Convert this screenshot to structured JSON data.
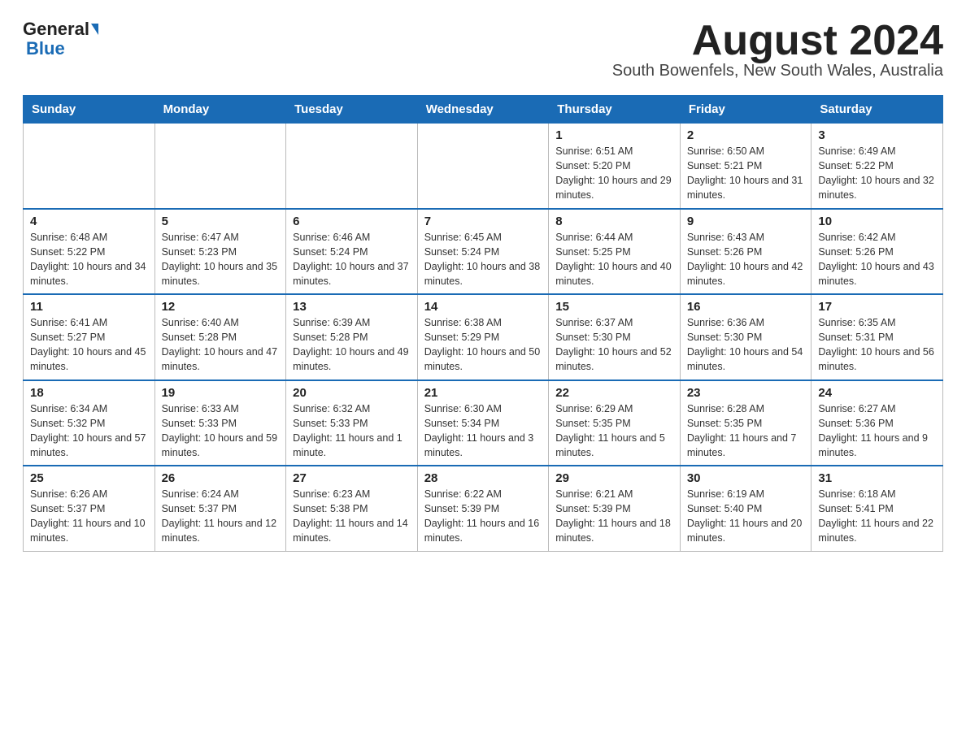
{
  "header": {
    "logo_general": "General",
    "logo_blue": "Blue",
    "month_title": "August 2024",
    "subtitle": "South Bowenfels, New South Wales, Australia"
  },
  "weekdays": [
    "Sunday",
    "Monday",
    "Tuesday",
    "Wednesday",
    "Thursday",
    "Friday",
    "Saturday"
  ],
  "weeks": [
    [
      {
        "day": "",
        "info": ""
      },
      {
        "day": "",
        "info": ""
      },
      {
        "day": "",
        "info": ""
      },
      {
        "day": "",
        "info": ""
      },
      {
        "day": "1",
        "info": "Sunrise: 6:51 AM\nSunset: 5:20 PM\nDaylight: 10 hours and 29 minutes."
      },
      {
        "day": "2",
        "info": "Sunrise: 6:50 AM\nSunset: 5:21 PM\nDaylight: 10 hours and 31 minutes."
      },
      {
        "day": "3",
        "info": "Sunrise: 6:49 AM\nSunset: 5:22 PM\nDaylight: 10 hours and 32 minutes."
      }
    ],
    [
      {
        "day": "4",
        "info": "Sunrise: 6:48 AM\nSunset: 5:22 PM\nDaylight: 10 hours and 34 minutes."
      },
      {
        "day": "5",
        "info": "Sunrise: 6:47 AM\nSunset: 5:23 PM\nDaylight: 10 hours and 35 minutes."
      },
      {
        "day": "6",
        "info": "Sunrise: 6:46 AM\nSunset: 5:24 PM\nDaylight: 10 hours and 37 minutes."
      },
      {
        "day": "7",
        "info": "Sunrise: 6:45 AM\nSunset: 5:24 PM\nDaylight: 10 hours and 38 minutes."
      },
      {
        "day": "8",
        "info": "Sunrise: 6:44 AM\nSunset: 5:25 PM\nDaylight: 10 hours and 40 minutes."
      },
      {
        "day": "9",
        "info": "Sunrise: 6:43 AM\nSunset: 5:26 PM\nDaylight: 10 hours and 42 minutes."
      },
      {
        "day": "10",
        "info": "Sunrise: 6:42 AM\nSunset: 5:26 PM\nDaylight: 10 hours and 43 minutes."
      }
    ],
    [
      {
        "day": "11",
        "info": "Sunrise: 6:41 AM\nSunset: 5:27 PM\nDaylight: 10 hours and 45 minutes."
      },
      {
        "day": "12",
        "info": "Sunrise: 6:40 AM\nSunset: 5:28 PM\nDaylight: 10 hours and 47 minutes."
      },
      {
        "day": "13",
        "info": "Sunrise: 6:39 AM\nSunset: 5:28 PM\nDaylight: 10 hours and 49 minutes."
      },
      {
        "day": "14",
        "info": "Sunrise: 6:38 AM\nSunset: 5:29 PM\nDaylight: 10 hours and 50 minutes."
      },
      {
        "day": "15",
        "info": "Sunrise: 6:37 AM\nSunset: 5:30 PM\nDaylight: 10 hours and 52 minutes."
      },
      {
        "day": "16",
        "info": "Sunrise: 6:36 AM\nSunset: 5:30 PM\nDaylight: 10 hours and 54 minutes."
      },
      {
        "day": "17",
        "info": "Sunrise: 6:35 AM\nSunset: 5:31 PM\nDaylight: 10 hours and 56 minutes."
      }
    ],
    [
      {
        "day": "18",
        "info": "Sunrise: 6:34 AM\nSunset: 5:32 PM\nDaylight: 10 hours and 57 minutes."
      },
      {
        "day": "19",
        "info": "Sunrise: 6:33 AM\nSunset: 5:33 PM\nDaylight: 10 hours and 59 minutes."
      },
      {
        "day": "20",
        "info": "Sunrise: 6:32 AM\nSunset: 5:33 PM\nDaylight: 11 hours and 1 minute."
      },
      {
        "day": "21",
        "info": "Sunrise: 6:30 AM\nSunset: 5:34 PM\nDaylight: 11 hours and 3 minutes."
      },
      {
        "day": "22",
        "info": "Sunrise: 6:29 AM\nSunset: 5:35 PM\nDaylight: 11 hours and 5 minutes."
      },
      {
        "day": "23",
        "info": "Sunrise: 6:28 AM\nSunset: 5:35 PM\nDaylight: 11 hours and 7 minutes."
      },
      {
        "day": "24",
        "info": "Sunrise: 6:27 AM\nSunset: 5:36 PM\nDaylight: 11 hours and 9 minutes."
      }
    ],
    [
      {
        "day": "25",
        "info": "Sunrise: 6:26 AM\nSunset: 5:37 PM\nDaylight: 11 hours and 10 minutes."
      },
      {
        "day": "26",
        "info": "Sunrise: 6:24 AM\nSunset: 5:37 PM\nDaylight: 11 hours and 12 minutes."
      },
      {
        "day": "27",
        "info": "Sunrise: 6:23 AM\nSunset: 5:38 PM\nDaylight: 11 hours and 14 minutes."
      },
      {
        "day": "28",
        "info": "Sunrise: 6:22 AM\nSunset: 5:39 PM\nDaylight: 11 hours and 16 minutes."
      },
      {
        "day": "29",
        "info": "Sunrise: 6:21 AM\nSunset: 5:39 PM\nDaylight: 11 hours and 18 minutes."
      },
      {
        "day": "30",
        "info": "Sunrise: 6:19 AM\nSunset: 5:40 PM\nDaylight: 11 hours and 20 minutes."
      },
      {
        "day": "31",
        "info": "Sunrise: 6:18 AM\nSunset: 5:41 PM\nDaylight: 11 hours and 22 minutes."
      }
    ]
  ]
}
